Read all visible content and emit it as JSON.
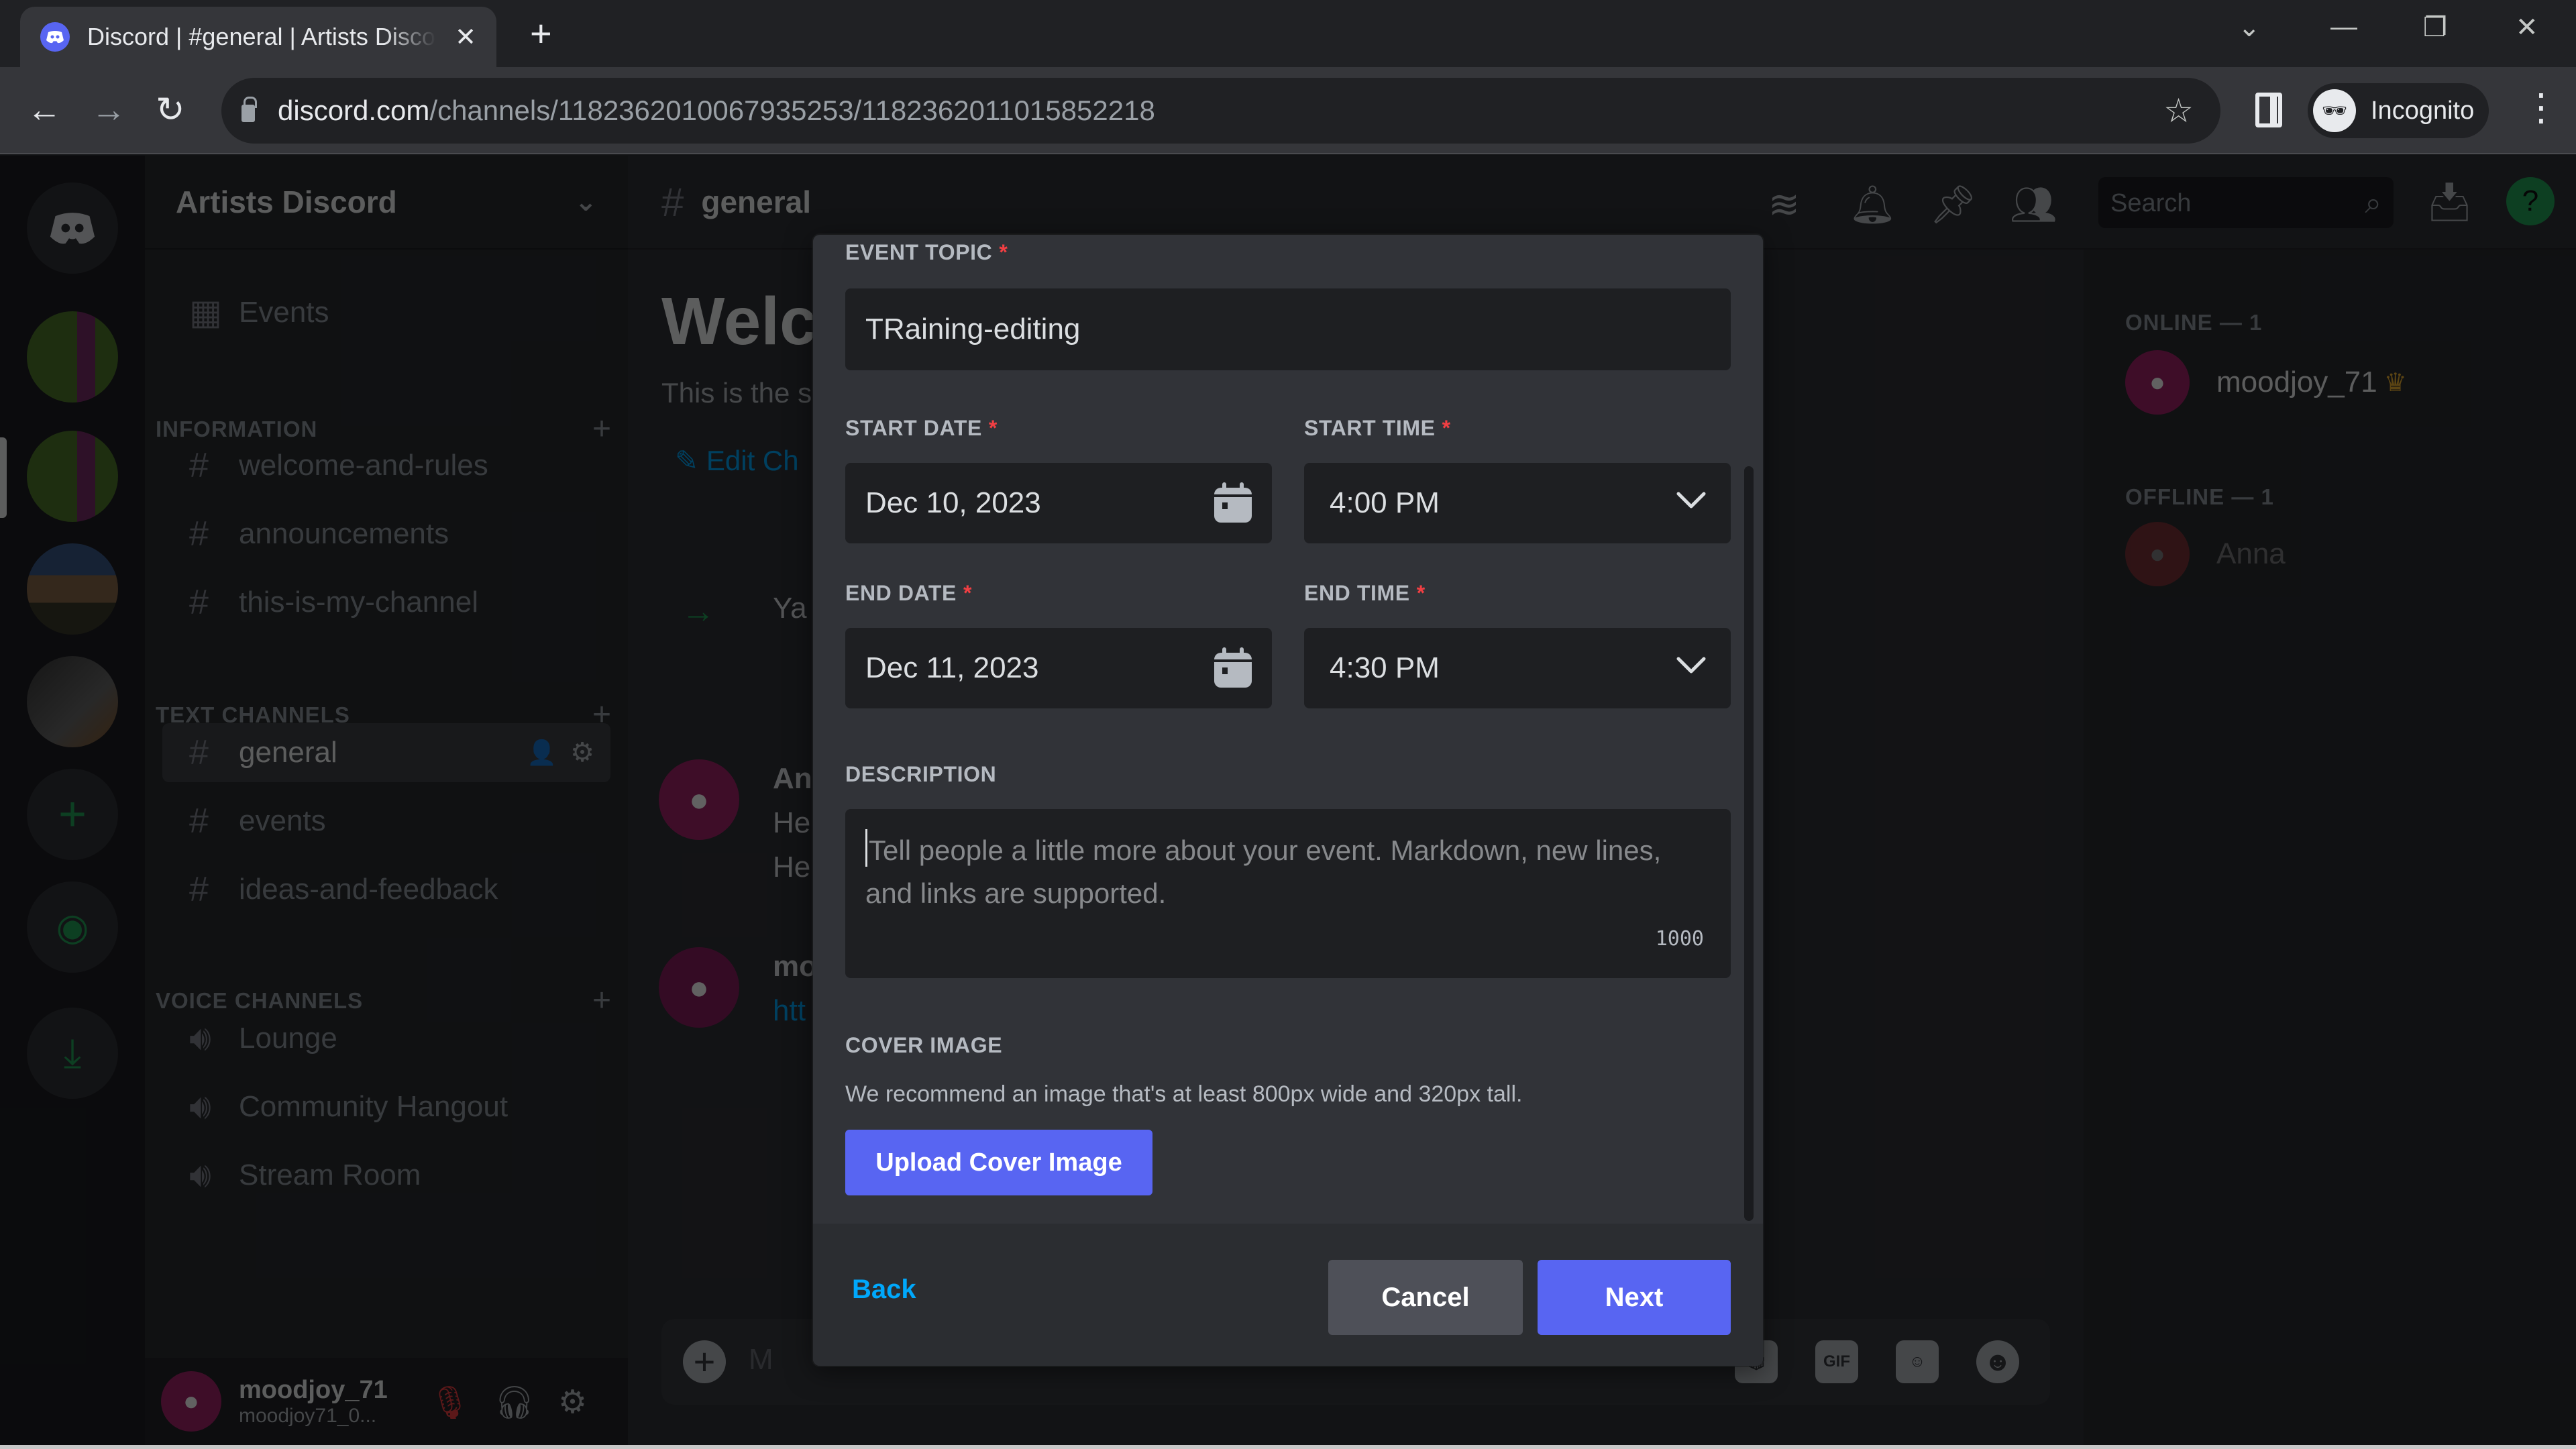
{
  "browser": {
    "tab_title": "Discord | #general | Artists Discord",
    "new_tab_label": "+",
    "url_host": "discord.com",
    "url_path": "/channels/1182362010067935253/1182362011015852218",
    "profile_label": "Incognito",
    "icons": {
      "back": "arrow-left-icon",
      "forward": "arrow-right-icon",
      "reload": "reload-icon",
      "bookmark": "star-icon",
      "side_panel": "side-panel-icon",
      "menu": "kebab-menu-icon",
      "tab_list": "chevron-down-icon",
      "minimize": "minimize-icon",
      "restore": "restore-icon",
      "close": "close-icon"
    }
  },
  "discord": {
    "server_name": "Artists Discord",
    "events_label": "Events",
    "categories": [
      {
        "name": "INFORMATION",
        "channels": [
          {
            "name": "welcome-and-rules",
            "type": "text"
          },
          {
            "name": "announcements",
            "type": "text"
          },
          {
            "name": "this-is-my-channel",
            "type": "text"
          }
        ]
      },
      {
        "name": "TEXT CHANNELS",
        "channels": [
          {
            "name": "general",
            "type": "text",
            "active": true
          },
          {
            "name": "events",
            "type": "text"
          },
          {
            "name": "ideas-and-feedback",
            "type": "text"
          }
        ]
      },
      {
        "name": "VOICE CHANNELS",
        "channels": [
          {
            "name": "Lounge",
            "type": "voice"
          },
          {
            "name": "Community Hangout",
            "type": "voice"
          },
          {
            "name": "Stream Room",
            "type": "voice"
          }
        ]
      }
    ],
    "user": {
      "display_name": "moodjoy_71",
      "username": "moodjoy71_0..."
    },
    "chat": {
      "channel_name": "general",
      "welcome_title": "Welco",
      "welcome_sub": "This is the s",
      "edit_channel_label": "Edit Ch",
      "messages": [
        {
          "line1": "Ya"
        },
        {
          "line1": "An",
          "line2": "He",
          "line3": "He"
        },
        {
          "line1": "mo",
          "line2": "htt"
        }
      ],
      "composer_placeholder": "M",
      "composer_icons": [
        "gift-icon",
        "gif-icon",
        "sticker-icon",
        "emoji-icon"
      ],
      "gif_label": "GIF"
    },
    "search_placeholder": "Search",
    "members": {
      "online_header": "ONLINE — 1",
      "offline_header": "OFFLINE — 1",
      "online": [
        {
          "name": "moodjoy_71",
          "owner": true
        }
      ],
      "offline": [
        {
          "name": "Anna"
        }
      ]
    }
  },
  "modal": {
    "event_topic": {
      "label": "EVENT TOPIC",
      "required_mark": "*",
      "value": "TRaining-editing"
    },
    "start_date": {
      "label": "START DATE",
      "required_mark": "*",
      "value": "Dec 10, 2023"
    },
    "start_time": {
      "label": "START TIME",
      "required_mark": "*",
      "value": "4:00 PM"
    },
    "end_date": {
      "label": "END DATE",
      "required_mark": "*",
      "value": "Dec 11, 2023"
    },
    "end_time": {
      "label": "END TIME",
      "required_mark": "*",
      "value": "4:30 PM"
    },
    "description": {
      "label": "DESCRIPTION",
      "value": "",
      "placeholder": "Tell people a little more about your event. Markdown, new lines, and links are supported.",
      "char_remaining": "1000"
    },
    "cover_image": {
      "label": "COVER IMAGE",
      "hint": "We recommend an image that's at least 800px wide and 320px tall.",
      "button": "Upload Cover Image"
    },
    "footer": {
      "back": "Back",
      "cancel": "Cancel",
      "next": "Next"
    }
  },
  "colors": {
    "brand": "#5865f2",
    "link": "#00a8fc",
    "required": "#f23f43",
    "modal_bg": "#313338",
    "input_bg": "#1e1f22"
  }
}
